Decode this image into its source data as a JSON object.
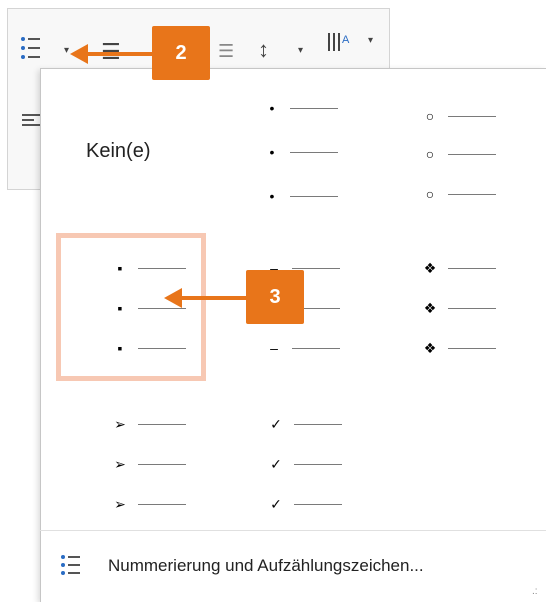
{
  "gallery": {
    "none_label": "Kein(e)",
    "bullets": {
      "round_filled": "•",
      "circle_open": "○",
      "square": "▪",
      "dash": "–",
      "diamond_cluster": "❖",
      "arrowhead": "➢",
      "checkmark": "✓"
    }
  },
  "footer": {
    "label": "Nummerierung und Aufzählungszeichen..."
  },
  "callouts": {
    "step2": "2",
    "step3": "3"
  },
  "colors": {
    "callout": "#e8751a",
    "highlight": "#f7c8b3"
  },
  "icons": [
    "bullet-list-icon",
    "numbered-list-icon",
    "line-spacing-icon",
    "sort-icon",
    "align-left-icon"
  ]
}
